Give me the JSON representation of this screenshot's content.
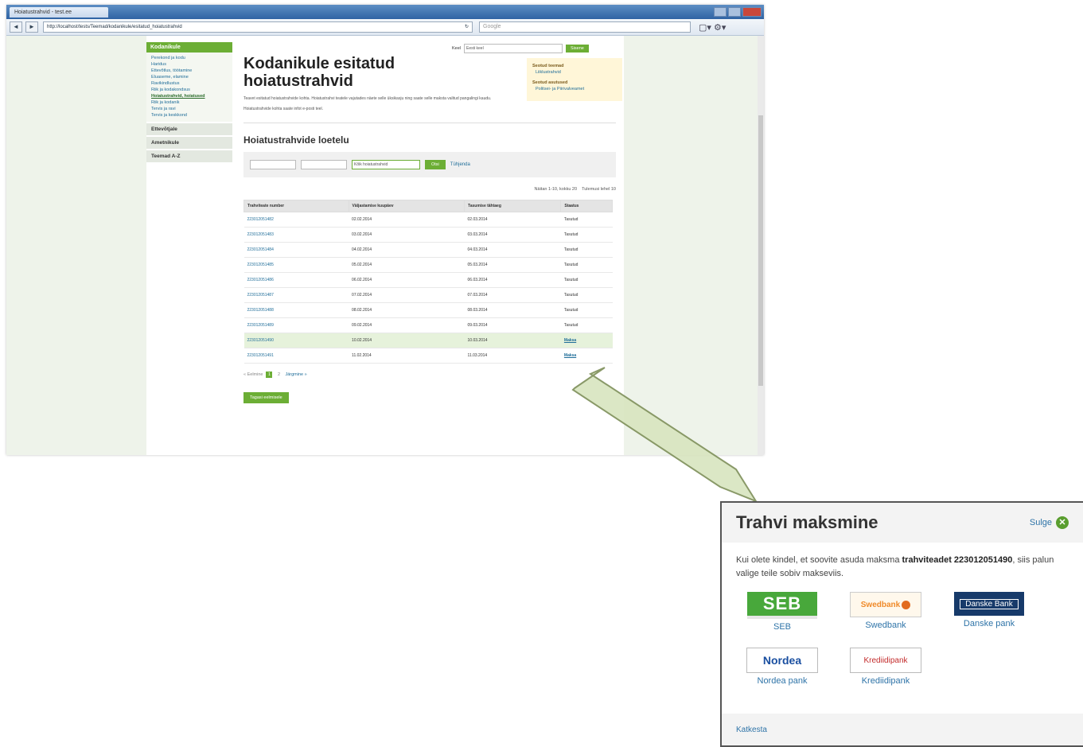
{
  "browser": {
    "tab_title": "Hoiatustrahvid - test.ee",
    "url": "http://localhost/tests/Teemad/kodanikule/esitatud_hoiatustrahvid",
    "search_placeholder": "Google"
  },
  "site": {
    "language_label": "Keel",
    "language_value": "Eesti keel",
    "login_button": "Sisene",
    "sidebar": {
      "header": "Kodanikule",
      "items": [
        "Perekond ja kodu",
        "Haridus",
        "Ettevõtlus, töötamine",
        "Eluaseme, elamine",
        "Ravikindlustus",
        "Riik ja kodakondsus",
        "Hoiatustrahvid, hoiatused",
        "Riik ja kodanik",
        "Tervis ja ravi",
        "Tervis ja keskkond"
      ],
      "sections": [
        "Ettevõtjale",
        "Ametnikule",
        "Teemad A-Z"
      ]
    },
    "page_title": "Kodanikule esitatud hoiatustrahvid",
    "intro": "Teavet esitatud hoiatustrahvide kohta. Hoiatustrahvi teatele vajutades näete selle üksikasju ning saate selle maksta valitud pangalingi kaudu.",
    "contact_text": "Hoiatustrahvide kohta saate infot e-posti teel.",
    "infobox": {
      "heading1": "Seotud teemad",
      "link1": "Liiklustrahvid",
      "heading2": "Seotud asutused",
      "link2": "Politsei- ja Piirivalveamet"
    },
    "list_title": "Hoiatustrahvide loetelu",
    "filter_select": "Kõik hoiatustrahvid",
    "filter_button": "Otsi",
    "filter_clear": "Tühjenda",
    "results_info": "Näitan 1-10, kokku 20",
    "per_page_label": "Tulemusi lehel",
    "per_page_value": "10",
    "table": {
      "headers": [
        "Trahviteate number",
        "Väljastamise kuupäev",
        "Tasumise tähtaeg",
        "Staatus"
      ],
      "rows": [
        [
          "223012051482",
          "02.02.2014",
          "02.03.2014",
          "Tasutud"
        ],
        [
          "223012051483",
          "03.02.2014",
          "03.03.2014",
          "Tasutud"
        ],
        [
          "223012051484",
          "04.02.2014",
          "04.03.2014",
          "Tasutud"
        ],
        [
          "223012051485",
          "05.02.2014",
          "05.03.2014",
          "Tasutud"
        ],
        [
          "223012051486",
          "06.02.2014",
          "06.03.2014",
          "Tasutud"
        ],
        [
          "223012051487",
          "07.02.2014",
          "07.03.2014",
          "Tasutud"
        ],
        [
          "223012051488",
          "08.02.2014",
          "08.03.2014",
          "Tasutud"
        ],
        [
          "223012051489",
          "09.02.2014",
          "09.03.2014",
          "Tasutud"
        ],
        [
          "223012051490",
          "10.02.2014",
          "10.03.2014",
          "Maksa"
        ],
        [
          "223012051491",
          "11.02.2014",
          "11.03.2014",
          "Maksa"
        ]
      ]
    },
    "pager": {
      "prev": "« Eelmine",
      "pages": [
        "1",
        "2"
      ],
      "next": "Järgmine »"
    },
    "bottom_button": "Tagasi eelmisele"
  },
  "modal": {
    "title": "Trahvi maksmine",
    "close_label": "Sulge",
    "text_before": "Kui olete kindel, et soovite asuda maksma ",
    "text_bold": "trahviteadet 223012051490",
    "text_after": ", siis palun valige teile sobiv makseviis.",
    "banks": [
      {
        "logo": "SEB",
        "label": "SEB"
      },
      {
        "logo": "Swedbank",
        "label": "Swedbank"
      },
      {
        "logo": "Danske Bank",
        "label": "Danske pank"
      },
      {
        "logo": "Nordea",
        "label": "Nordea pank"
      },
      {
        "logo": "Krediidipank",
        "label": "Krediidipank"
      }
    ],
    "cancel_label": "Katkesta"
  },
  "colors": {
    "accent_green": "#6cae35",
    "link_blue": "#1f6d99",
    "highlight_row": "#e6f2db"
  }
}
